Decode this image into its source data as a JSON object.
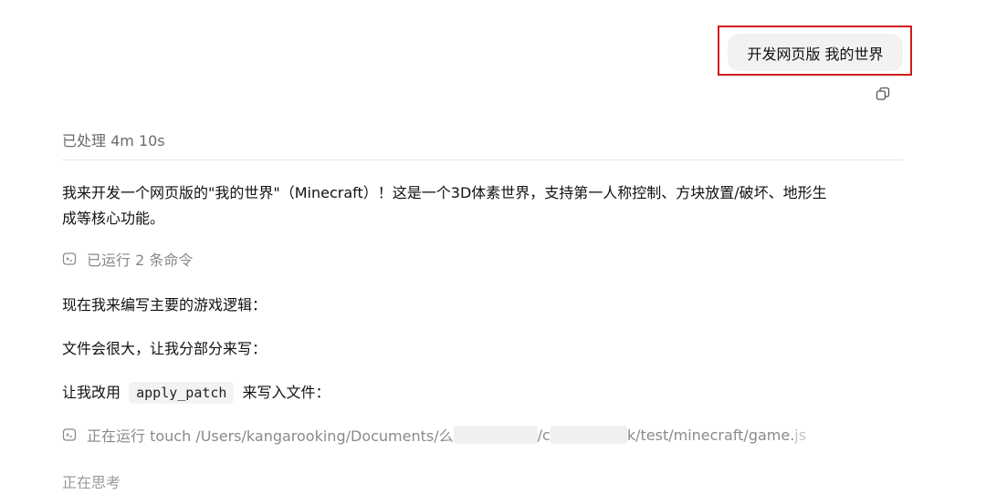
{
  "user_message": {
    "text": "开发网页版 我的世界"
  },
  "icons": {
    "copy": "copy-icon",
    "terminal": "terminal-icon"
  },
  "status": {
    "processed": "已处理 4m 10s"
  },
  "assistant": {
    "intro_line1": "我来开发一个网页版的\"我的世界\"（Minecraft）！这是一个3D体素世界，支持第一人称控制、方块放置/破坏、地形生",
    "intro_line2": "成等核心功能。",
    "ran_commands": "已运行 2 条命令",
    "writing_logic": "现在我来编写主要的游戏逻辑：",
    "file_large": "文件会很大，让我分部分来写：",
    "patch_prefix": "让我改用",
    "patch_code": "apply_patch",
    "patch_suffix": "来写入文件：",
    "running_prefix": "正在运行 touch /Users/kangarooking/Documents/",
    "running_seg1": "么",
    "running_seg2": "/c",
    "running_seg3": "k/test/minecraft/game.",
    "running_seg4": "js",
    "thinking": "正在思考"
  },
  "colors": {
    "highlight_border": "#d11a1a",
    "bubble_bg": "#f2f2f2",
    "muted_text": "#8a8a8a"
  }
}
